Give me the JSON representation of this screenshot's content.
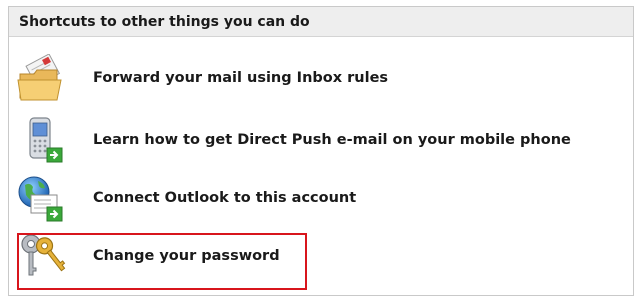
{
  "panel": {
    "title": "Shortcuts to other things you can do"
  },
  "shortcuts": [
    {
      "icon": "mail-folder-icon",
      "label": "Forward your mail using Inbox rules"
    },
    {
      "icon": "mobile-phone-icon",
      "label": "Learn how to get Direct Push e-mail on your mobile phone"
    },
    {
      "icon": "globe-mail-icon",
      "label": "Connect Outlook to this account"
    },
    {
      "icon": "keys-icon",
      "label": "Change your password"
    }
  ],
  "colors": {
    "highlight": "#d8151c",
    "header_bg": "#eeeeee",
    "arrow_green": "#3aa83a"
  }
}
